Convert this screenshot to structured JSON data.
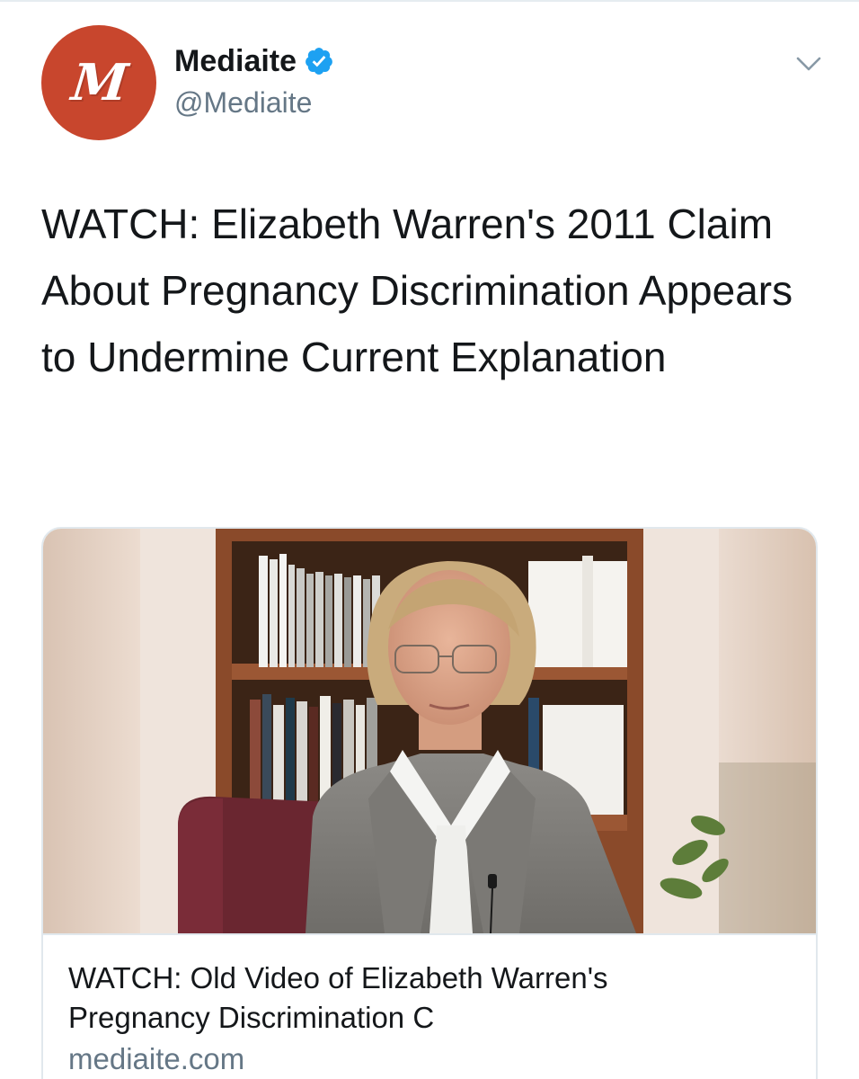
{
  "account": {
    "display_name": "Mediaite",
    "handle": "@Mediaite",
    "avatar_letter": "M",
    "avatar_color": "#c8462d",
    "verified_color": "#1da1f2"
  },
  "tweet": {
    "text": "WATCH: Elizabeth Warren's 2011 Claim About Pregnancy Discrimination Appears to Undermine Current Explanation"
  },
  "card": {
    "title_line1": "WATCH: Old Video of Elizabeth Warren's",
    "title_line2": "Pregnancy Discrimination C",
    "domain": "mediaite.com"
  },
  "icons": {
    "verified": "verified-badge-icon",
    "menu": "chevron-down-icon"
  }
}
